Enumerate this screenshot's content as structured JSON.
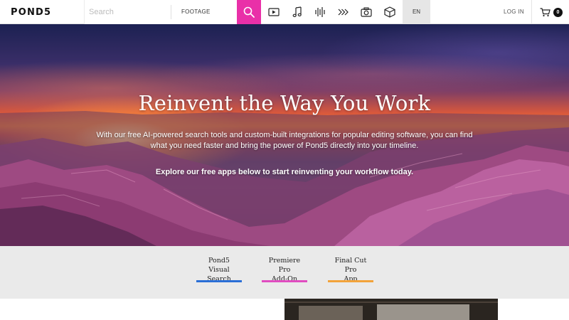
{
  "brand": {
    "logo_text": "POND5"
  },
  "search": {
    "placeholder": "Search",
    "value": "",
    "type_label": "FOOTAGE"
  },
  "nav": {
    "media_icons": [
      "video-icon",
      "music-icon",
      "sound-effects-icon",
      "after-effects-icon",
      "photo-icon",
      "3d-icon"
    ],
    "language": "EN",
    "login_label": "LOG IN",
    "cart_count": "0"
  },
  "hero": {
    "title": "Reinvent the Way You Work",
    "description": "With our free AI-powered search tools and custom-built integrations for popular editing software, you can find what you need faster and bring the power of Pond5 directly into your timeline.",
    "cta": "Explore our free apps below to start reinventing your workflow today."
  },
  "app_tabs": [
    {
      "label": "Pond5\nVisual Search",
      "color": "#2b6fd6"
    },
    {
      "label": "Premiere Pro\nAdd-On",
      "color": "#e04cc0"
    },
    {
      "label": "Final Cut Pro\nApp",
      "color": "#f2a33a"
    }
  ],
  "colors": {
    "accent": "#e930a8",
    "language_bg": "#e6e6e6",
    "tab_bar_bg": "#eaeaea"
  }
}
